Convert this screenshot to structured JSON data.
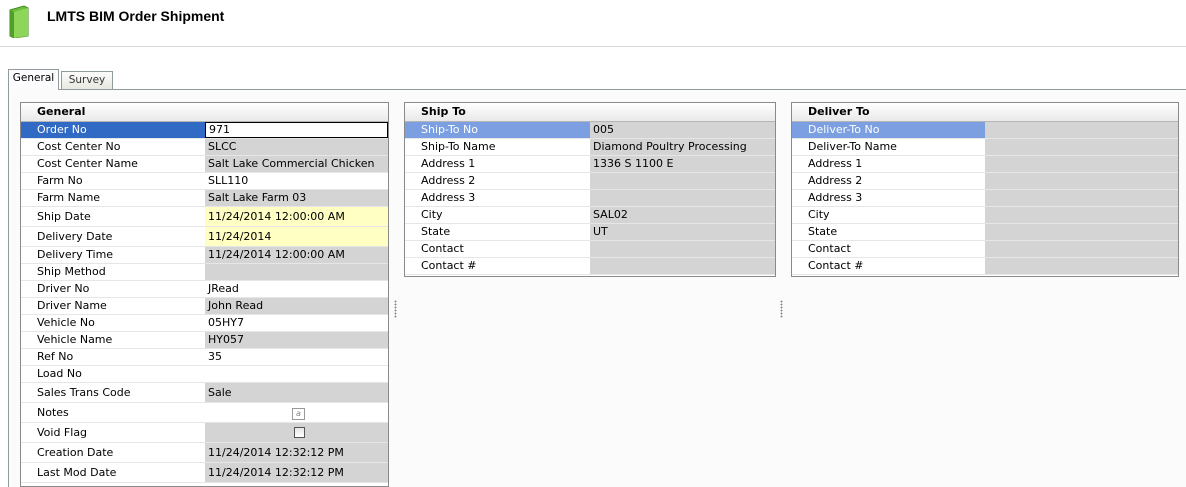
{
  "app": {
    "title": "LMTS BIM Order Shipment"
  },
  "tabs": [
    {
      "label": "General",
      "active": true
    },
    {
      "label": "Survey",
      "active": false
    }
  ],
  "general": {
    "header": "General",
    "rows": [
      {
        "label": "Order No",
        "value": "971"
      },
      {
        "label": "Cost Center No",
        "value": "SLCC"
      },
      {
        "label": "Cost Center Name",
        "value": "Salt Lake Commercial Chicken"
      },
      {
        "label": "Farm No",
        "value": "SLL110"
      },
      {
        "label": "Farm Name",
        "value": "Salt Lake Farm 03"
      },
      {
        "label": "Ship Date",
        "value": "11/24/2014 12:00:00 AM"
      },
      {
        "label": "Delivery Date",
        "value": "11/24/2014"
      },
      {
        "label": "Delivery Time",
        "value": "11/24/2014 12:00:00 AM"
      },
      {
        "label": "Ship Method",
        "value": ""
      },
      {
        "label": "Driver No",
        "value": "JRead"
      },
      {
        "label": "Driver Name",
        "value": "John Read"
      },
      {
        "label": "Vehicle No",
        "value": "05HY7"
      },
      {
        "label": "Vehicle Name",
        "value": "HY057"
      },
      {
        "label": "Ref No",
        "value": "35"
      },
      {
        "label": "Load No",
        "value": ""
      },
      {
        "label": "Sales Trans Code",
        "value": "Sale"
      },
      {
        "label": "Notes",
        "value": ""
      },
      {
        "label": "Void Flag",
        "value": ""
      },
      {
        "label": "Creation Date",
        "value": "11/24/2014 12:32:12 PM"
      },
      {
        "label": "Last Mod Date",
        "value": "11/24/2014 12:32:12 PM"
      }
    ]
  },
  "ship_to": {
    "header": "Ship To",
    "rows": [
      {
        "label": "Ship-To No",
        "value": "005"
      },
      {
        "label": "Ship-To Name",
        "value": "Diamond Poultry Processing"
      },
      {
        "label": "Address 1",
        "value": "1336 S 1100 E"
      },
      {
        "label": "Address 2",
        "value": ""
      },
      {
        "label": "Address 3",
        "value": ""
      },
      {
        "label": "City",
        "value": "SAL02"
      },
      {
        "label": "State",
        "value": "UT"
      },
      {
        "label": "Contact",
        "value": ""
      },
      {
        "label": "Contact #",
        "value": ""
      }
    ]
  },
  "deliver_to": {
    "header": "Deliver To",
    "rows": [
      {
        "label": "Deliver-To No",
        "value": ""
      },
      {
        "label": "Deliver-To Name",
        "value": ""
      },
      {
        "label": "Address 1",
        "value": ""
      },
      {
        "label": "Address 2",
        "value": ""
      },
      {
        "label": "Address 3",
        "value": ""
      },
      {
        "label": "City",
        "value": ""
      },
      {
        "label": "State",
        "value": ""
      },
      {
        "label": "Contact",
        "value": ""
      },
      {
        "label": "Contact #",
        "value": ""
      }
    ]
  },
  "colors": {
    "selected_row": "#316ac5",
    "selected_row_light": "#7b9fe0",
    "readonly_cell": "#d4d4d4",
    "required_cell": "#ffffc4"
  },
  "icons": {
    "app": "green-document-icon",
    "notes": "memo-edit-icon",
    "void_flag": "checkbox"
  }
}
